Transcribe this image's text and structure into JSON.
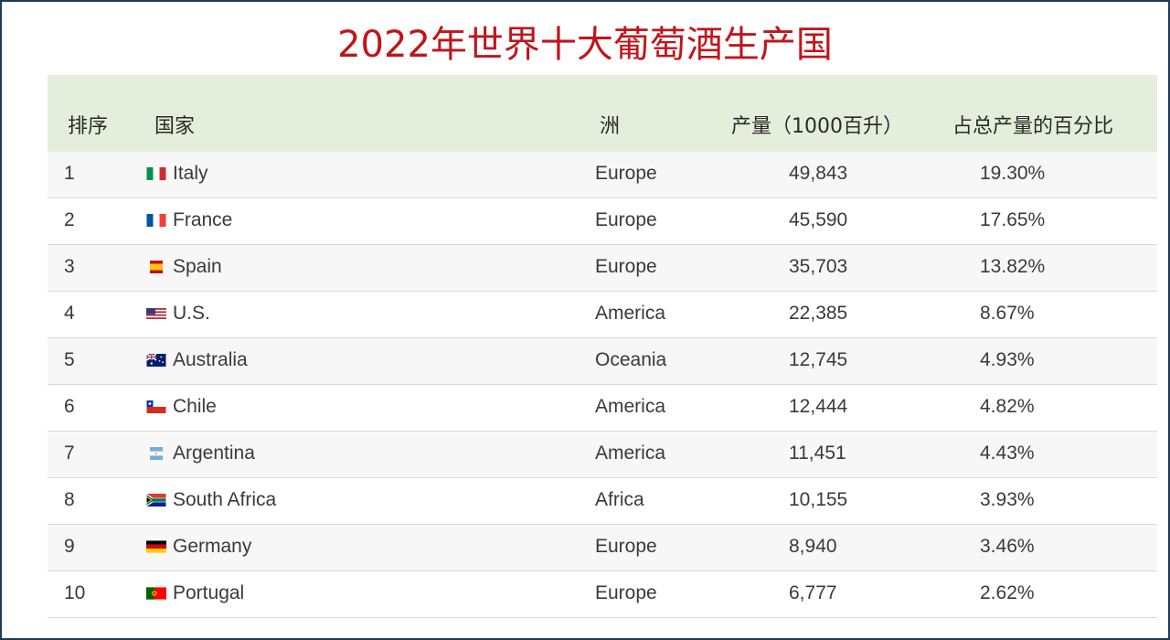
{
  "title": "2022年世界十大葡萄酒生产国",
  "headers": {
    "rank": "排序",
    "country": "国家",
    "continent": "洲",
    "production": "产量（1000百升）",
    "share": "占总产量的百分比"
  },
  "rows": [
    {
      "rank": "1",
      "country": "Italy",
      "flag": "italy-flag",
      "continent": "Europe",
      "production": "49,843",
      "share": "19.30%"
    },
    {
      "rank": "2",
      "country": "France",
      "flag": "france-flag",
      "continent": "Europe",
      "production": "45,590",
      "share": "17.65%"
    },
    {
      "rank": "3",
      "country": "Spain",
      "flag": "spain-flag",
      "continent": "Europe",
      "production": "35,703",
      "share": "13.82%"
    },
    {
      "rank": "4",
      "country": "U.S.",
      "flag": "us-flag",
      "continent": "America",
      "production": "22,385",
      "share": "8.67%"
    },
    {
      "rank": "5",
      "country": "Australia",
      "flag": "australia-flag",
      "continent": "Oceania",
      "production": "12,745",
      "share": "4.93%"
    },
    {
      "rank": "6",
      "country": "Chile",
      "flag": "chile-flag",
      "continent": "America",
      "production": "12,444",
      "share": "4.82%"
    },
    {
      "rank": "7",
      "country": "Argentina",
      "flag": "argentina-flag",
      "continent": "America",
      "production": "11,451",
      "share": "4.43%"
    },
    {
      "rank": "8",
      "country": "South Africa",
      "flag": "south-africa-flag",
      "continent": "Africa",
      "production": "10,155",
      "share": "3.93%"
    },
    {
      "rank": "9",
      "country": "Germany",
      "flag": "germany-flag",
      "continent": "Europe",
      "production": "8,940",
      "share": "3.46%"
    },
    {
      "rank": "10",
      "country": "Portugal",
      "flag": "portugal-flag",
      "continent": "Europe",
      "production": "6,777",
      "share": "2.62%"
    }
  ],
  "colors": {
    "title": "#c0151b",
    "header_bg": "#e4eedb",
    "border": "#1f3a5c"
  }
}
